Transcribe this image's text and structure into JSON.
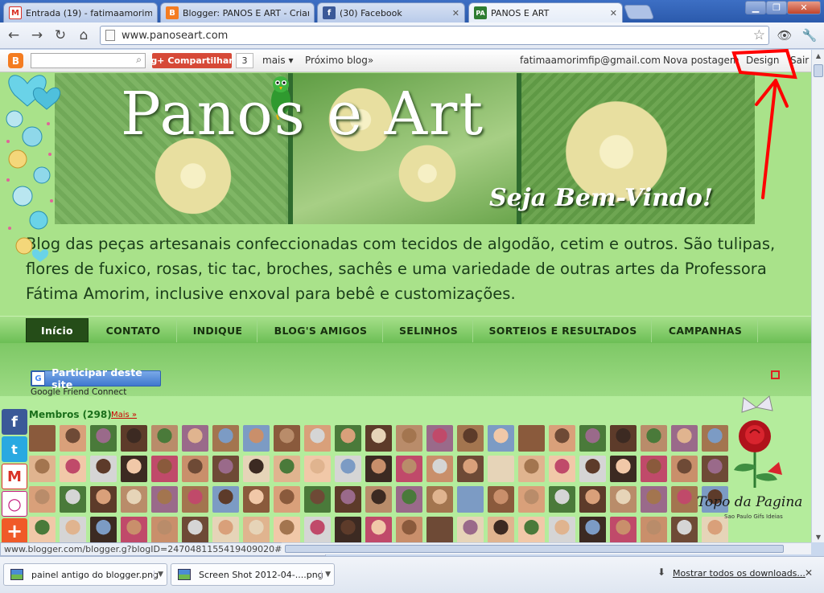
{
  "tabs": [
    {
      "label": "Entrada (19) - fatimaamorimfi",
      "favicon": "M",
      "color": "#d93025"
    },
    {
      "label": "Blogger: PANOS E ART - Criar",
      "favicon": "B",
      "color": "#f47c20"
    },
    {
      "label": "(30) Facebook",
      "favicon": "f",
      "color": "#3b5998"
    },
    {
      "label": "PANOS E ART",
      "favicon": "PA",
      "color": "#2e7d32"
    }
  ],
  "toolbar": {
    "url": "www.panoseart.com"
  },
  "blogger_nav": {
    "share_label": "Compartilhar",
    "share_prefix": "g+",
    "share_count": "3",
    "more_label": "mais ▾",
    "next_blog_label": "Próximo blog»",
    "email": "fatimaamorimfip@gmail.com",
    "new_post_label": "Nova postagem",
    "design_label": "Design",
    "logout_label": "Sair"
  },
  "header": {
    "title": "Panos e Art",
    "welcome": "Seja Bem-Vindo!"
  },
  "description": "Blog das peças artesanais confeccionadas com tecidos de algodão, cetim e outros. São tulipas, flores de fuxico, rosas, tic tac, broches, sachês e uma variedade de outras artes da Professora Fátima Amorim, inclusive enxoval para bebê e customizações.",
  "menu": [
    {
      "label": "Início",
      "active": true
    },
    {
      "label": "CONTATO",
      "active": false
    },
    {
      "label": "INDIQUE",
      "active": false
    },
    {
      "label": "BLOG'S AMIGOS",
      "active": false
    },
    {
      "label": "SELINHOS",
      "active": false
    },
    {
      "label": "SORTEIOS E RESULTADOS",
      "active": false
    },
    {
      "label": "CAMPANHAS",
      "active": false
    }
  ],
  "friend_connect": {
    "join_label": "Participar deste site",
    "caption": "Google Friend Connect",
    "members_title": "Membros (298)",
    "more_label": "Mais »"
  },
  "widgets": {
    "topo": "Topo da Pagina",
    "topo_small": "Sao Paulo Gifs Ideias"
  },
  "status_text": "www.blogger.com/blogger.g?blogID=2470481155419409020#template",
  "downloads": {
    "items": [
      "painel antigo do blogger.png",
      "Screen Shot 2012-04-....png"
    ],
    "show_all": "Mostrar todos os downloads..."
  },
  "colors": {
    "page_bg": "#a9e28a",
    "menu_active": "#254d18",
    "annotation": "#ff0000"
  }
}
